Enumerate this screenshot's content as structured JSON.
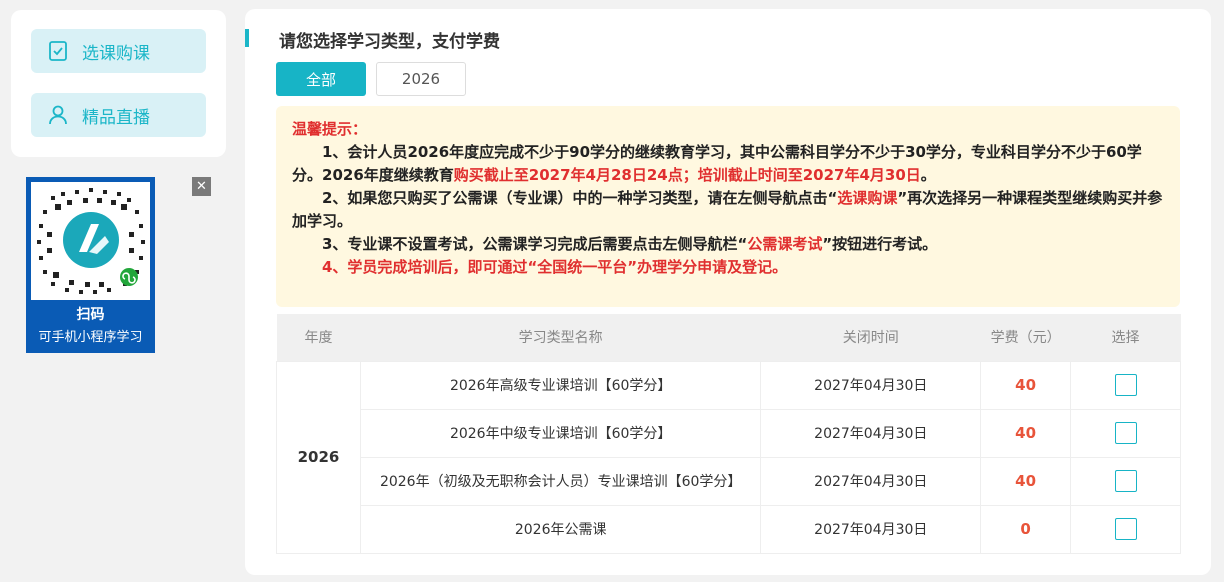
{
  "sidebar": {
    "items": [
      {
        "label": "选课购课",
        "icon": "checklist-icon"
      },
      {
        "label": "精品直播",
        "icon": "user-icon"
      }
    ]
  },
  "qr": {
    "line1": "扫码",
    "line2": "可手机小程序学习",
    "close": "✕"
  },
  "main": {
    "title": "请您选择学习类型，支付学费",
    "tabs": [
      {
        "label": "全部",
        "active": true
      },
      {
        "label": "2026",
        "active": false
      }
    ]
  },
  "notice": {
    "head": "温馨提示：",
    "p1": "1、会计人员2026年度应完成不少于90学分的继续教育学习，其中公需科目学分不少于30学分，专业科目学分不少于60学分。",
    "p1b": "2026年度继续教育",
    "p1red": "购买截止至2027年4月28日24点；培训截止时间至2027年4月30日",
    "p1end": "。",
    "p2a": "2、如果您只购买了公需课（专业课）中的一种学习类型，请在左侧导航点击“",
    "p2red": "选课购课",
    "p2b": "”再次选择另一种课程类型继续购买并参加学习。",
    "p3a": "3、专业课不设置考试，公需课学习完成后需要点击左侧导航栏“",
    "p3red": "公需课考试",
    "p3b": "”按钮进行考试。",
    "p4": "4、学员完成培训后，即可通过“全国统一平台”办理学分申请及登记。"
  },
  "table": {
    "headers": [
      "年度",
      "学习类型名称",
      "关闭时间",
      "学费（元）",
      "选择"
    ],
    "year": "2026",
    "rows": [
      {
        "name": "2026年高级专业课培训【60学分】",
        "close": "2027年04月30日",
        "fee": "40"
      },
      {
        "name": "2026年中级专业课培训【60学分】",
        "close": "2027年04月30日",
        "fee": "40"
      },
      {
        "name": "2026年（初级及无职称会计人员）专业课培训【60学分】",
        "close": "2027年04月30日",
        "fee": "40"
      },
      {
        "name": "2026年公需课",
        "close": "2027年04月30日",
        "fee": "0"
      }
    ]
  },
  "colors": {
    "accent": "#17b4c6",
    "warn": "#e02f2f",
    "fee": "#e8543a",
    "noticeBg": "#fff8e0"
  }
}
